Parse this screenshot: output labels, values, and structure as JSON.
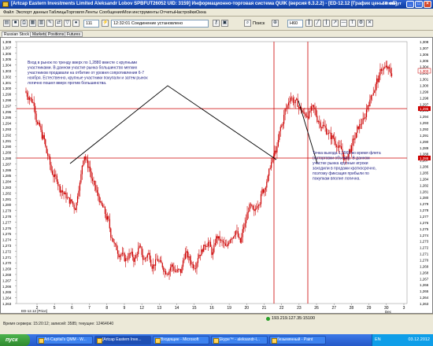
{
  "window": {
    "title": "[Artcap Eastern Investments Limited Aleksandr Lobov SPBFUT26052  UID: 3159] Информационно-торговая система QUIK (версия 6.3.2.2) - [ED-12.12 [График цены и об]",
    "status_right": "60 минут"
  },
  "menu": [
    "Файл",
    "Экспорт данных",
    "Таблицы",
    "Торговля",
    "Ленты",
    "Сообщения",
    "Мои инструменты",
    "Отчеты",
    "Настройки",
    "Окна"
  ],
  "toolbar": {
    "counter": "111",
    "time_status": "12:32:01  Соединение установлено",
    "search_label": "Поиск",
    "interval": "H60"
  },
  "tabs": [
    "Russian Stock",
    "Markets",
    "Positions",
    "Futures"
  ],
  "chart_data": {
    "type": "candlestick",
    "instrument_label": "ED-12.12 [Price]",
    "y_ticks": [
      "1,308",
      "1,307",
      "1,306",
      "1,305",
      "1,304",
      "1,303",
      "1,302",
      "1,301",
      "1,300",
      "1,299",
      "1,298",
      "1,297",
      "1,296",
      "1,295",
      "1,294",
      "1,293",
      "1,292",
      "1,291",
      "1,290",
      "1,289",
      "1,288",
      "1,287",
      "1,286",
      "1,285",
      "1,284",
      "1,283",
      "1,282",
      "1,281",
      "1,280",
      "1,279",
      "1,278",
      "1,277",
      "1,276",
      "1,275",
      "1,274",
      "1,273",
      "1,272",
      "1,271",
      "1,270",
      "1,269",
      "1,268",
      "1,267",
      "1,266",
      "1,265",
      "1,264",
      "1,263"
    ],
    "y_range": [
      1.263,
      1.308
    ],
    "right_y_ticks": [
      "1,308",
      "1,307",
      "1,306",
      "1,305",
      "1,304",
      "1,302",
      "1,301",
      "1,300",
      "1,299",
      "1,298",
      "1,297",
      "1,295",
      "1,294",
      "1,293",
      "1,292",
      "1,291",
      "1,290",
      "1,289",
      "1,288",
      "1,287",
      "1,286",
      "1,285",
      "1,284",
      "1,282",
      "1,281",
      "1,280",
      "1,279",
      "1,278",
      "1,277",
      "1,276",
      "1,275",
      "1,274",
      "1,273",
      "1,272",
      "1,271",
      "1,270",
      "1,269",
      "1,268",
      "1,267",
      "1,266",
      "1,265",
      "1,264",
      "1,263"
    ],
    "x_ticks": [
      "2",
      "5",
      "6",
      "7",
      "8",
      "9",
      "12",
      "13",
      "14",
      "15",
      "16",
      "19",
      "20",
      "21",
      "22",
      "23",
      "26",
      "27",
      "28",
      "29",
      "30",
      "3"
    ],
    "x_sub_label": "Dec",
    "current_price_label": "1,303",
    "hline_prices": [
      1.2965,
      1.288
    ],
    "hline_labels": [
      "1,296",
      "1,288"
    ],
    "closes": [
      1.2985,
      1.2975,
      1.2935,
      1.2915,
      1.2885,
      1.2855,
      1.2845,
      1.2825,
      1.2815,
      1.2805,
      1.2795,
      1.2835,
      1.2885,
      1.2865,
      1.2835,
      1.2815,
      1.2795,
      1.2775,
      1.2745,
      1.2725,
      1.2715,
      1.2705,
      1.2715,
      1.2705,
      1.2725,
      1.2705,
      1.2715,
      1.2695,
      1.2705,
      1.2695,
      1.2685,
      1.2695,
      1.2685,
      1.2685,
      1.2715,
      1.2705,
      1.2695,
      1.2715,
      1.2725,
      1.2735,
      1.2715,
      1.2745,
      1.2735,
      1.2725,
      1.2745,
      1.2755,
      1.2735,
      1.2765,
      1.2795,
      1.2785,
      1.2805,
      1.2825,
      1.2845,
      1.2875,
      1.2895,
      1.2935,
      1.2965,
      1.2985,
      1.2975,
      1.2965,
      1.2955,
      1.2955,
      1.2965,
      1.2945,
      1.2935,
      1.2925,
      1.2915,
      1.2905,
      1.2895,
      1.2875,
      1.2895,
      1.2915,
      1.2935,
      1.2945,
      1.2975,
      1.2995,
      1.3015,
      1.3035,
      1.3035,
      1.3025
    ]
  },
  "annotations": {
    "left_note": "Вход в рынок по тренду вверх по 1,2880 вместе с крупными участниками. В данном участке рынка большинство мелких участников продавали на отбитие от уровня сопротивления 6-7 ноября. Естественно, крупные участники покупали и затем рынок логично пошел вверх против большинства.",
    "right_note": "Точка выхода 1,2965 во время флета (наторговки объема). В данном участке рынка крупные игроки заходили в продажи краткосрочно, поэтому фиксация прибыли по покупкам вполне логична."
  },
  "status": {
    "info": "Время сервера: 15:20:12; записей: 3585; текущее: 12464640",
    "connection": "193.219.127.35:15100"
  },
  "taskbar": {
    "start": "пуск",
    "tasks": [
      "Art-Capital's QMM - W...",
      "[Artcap Eastern Inve...",
      "Входящие - Microsoft",
      "Skype™ - aleksandr-l...",
      "безымянный - Paint"
    ],
    "lang": "EN",
    "clock": "03.12.2012"
  },
  "colors": {
    "bull": "#cc0000",
    "bear": "#cc0000",
    "hline": "#cc0000",
    "vline": "#cc0000",
    "trendline": "#000000"
  }
}
